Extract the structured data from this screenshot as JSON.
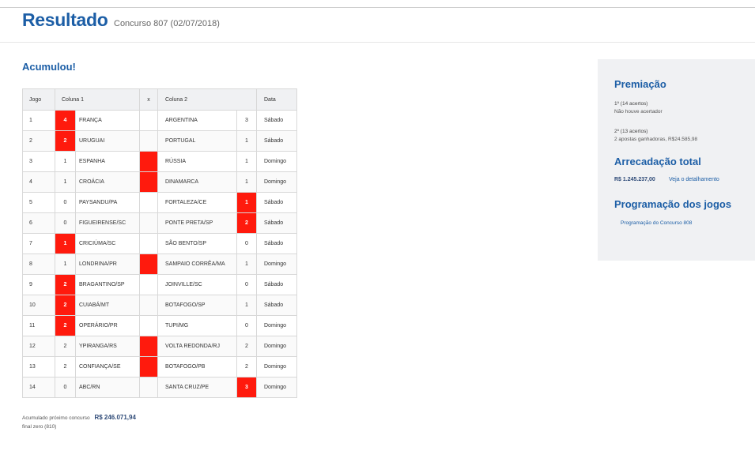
{
  "header": {
    "title": "Resultado",
    "subtitle": "Concurso 807 (02/07/2018)"
  },
  "status": "Acumulou!",
  "table": {
    "headers": {
      "jogo": "Jogo",
      "col1": "Coluna 1",
      "x": "x",
      "col2": "Coluna 2",
      "data": "Data"
    },
    "rows": [
      {
        "jogo": "1",
        "g1": "4",
        "t1": "FRANÇA",
        "x": "",
        "t2": "ARGENTINA",
        "g2": "3",
        "data": "Sábado",
        "mark": "col1"
      },
      {
        "jogo": "2",
        "g1": "2",
        "t1": "URUGUAI",
        "x": "",
        "t2": "PORTUGAL",
        "g2": "1",
        "data": "Sábado",
        "mark": "col1"
      },
      {
        "jogo": "3",
        "g1": "1",
        "t1": "ESPANHA",
        "x": "",
        "t2": "RÚSSIA",
        "g2": "1",
        "data": "Domingo",
        "mark": "x"
      },
      {
        "jogo": "4",
        "g1": "1",
        "t1": "CROÁCIA",
        "x": "",
        "t2": "DINAMARCA",
        "g2": "1",
        "data": "Domingo",
        "mark": "x"
      },
      {
        "jogo": "5",
        "g1": "0",
        "t1": "PAYSANDU/PA",
        "x": "",
        "t2": "FORTALEZA/CE",
        "g2": "1",
        "data": "Sábado",
        "mark": "col2"
      },
      {
        "jogo": "6",
        "g1": "0",
        "t1": "FIGUEIRENSE/SC",
        "x": "",
        "t2": "PONTE PRETA/SP",
        "g2": "2",
        "data": "Sábado",
        "mark": "col2"
      },
      {
        "jogo": "7",
        "g1": "1",
        "t1": "CRICIÚMA/SC",
        "x": "",
        "t2": "SÃO BENTO/SP",
        "g2": "0",
        "data": "Sábado",
        "mark": "col1"
      },
      {
        "jogo": "8",
        "g1": "1",
        "t1": "LONDRINA/PR",
        "x": "",
        "t2": "SAMPAIO CORRÊA/MA",
        "g2": "1",
        "data": "Domingo",
        "mark": "x"
      },
      {
        "jogo": "9",
        "g1": "2",
        "t1": "BRAGANTINO/SP",
        "x": "",
        "t2": "JOINVILLE/SC",
        "g2": "0",
        "data": "Sábado",
        "mark": "col1"
      },
      {
        "jogo": "10",
        "g1": "2",
        "t1": "CUIABÁ/MT",
        "x": "",
        "t2": "BOTAFOGO/SP",
        "g2": "1",
        "data": "Sábado",
        "mark": "col1"
      },
      {
        "jogo": "11",
        "g1": "2",
        "t1": "OPERÁRIO/PR",
        "x": "",
        "t2": "TUPI/MG",
        "g2": "0",
        "data": "Domingo",
        "mark": "col1"
      },
      {
        "jogo": "12",
        "g1": "2",
        "t1": "YPIRANGA/RS",
        "x": "",
        "t2": "VOLTA REDONDA/RJ",
        "g2": "2",
        "data": "Domingo",
        "mark": "x"
      },
      {
        "jogo": "13",
        "g1": "2",
        "t1": "CONFIANÇA/SE",
        "x": "",
        "t2": "BOTAFOGO/PB",
        "g2": "2",
        "data": "Domingo",
        "mark": "x"
      },
      {
        "jogo": "14",
        "g1": "0",
        "t1": "ABC/RN",
        "x": "",
        "t2": "SANTA CRUZ/PE",
        "g2": "3",
        "data": "Domingo",
        "mark": "col2"
      }
    ]
  },
  "footer": {
    "acumulado_label": "Acumulado próximo concurso",
    "acumulado_value": "R$ 246.071,94",
    "final_zero": "final zero (810)"
  },
  "sidebar": {
    "premiacao_title": "Premiação",
    "prize1_label": "1º (14 acertos)",
    "prize1_text": "Não houve acertador",
    "prize2_label": "2º (13 acertos)",
    "prize2_text": "2 apostas ganhadoras, R$24.585,98",
    "arrecadacao_title": "Arrecadação total",
    "arrecadacao_value": "R$ 1.245.237,00",
    "detalhamento_link": "Veja o detalhamento",
    "programacao_title": "Programação dos jogos",
    "programacao_link": "Programação do Concurso 808"
  },
  "colors": {
    "accent": "#1c5ea6",
    "mark": "#ff1a0d",
    "sidebar_bg": "#f0f1f3"
  }
}
